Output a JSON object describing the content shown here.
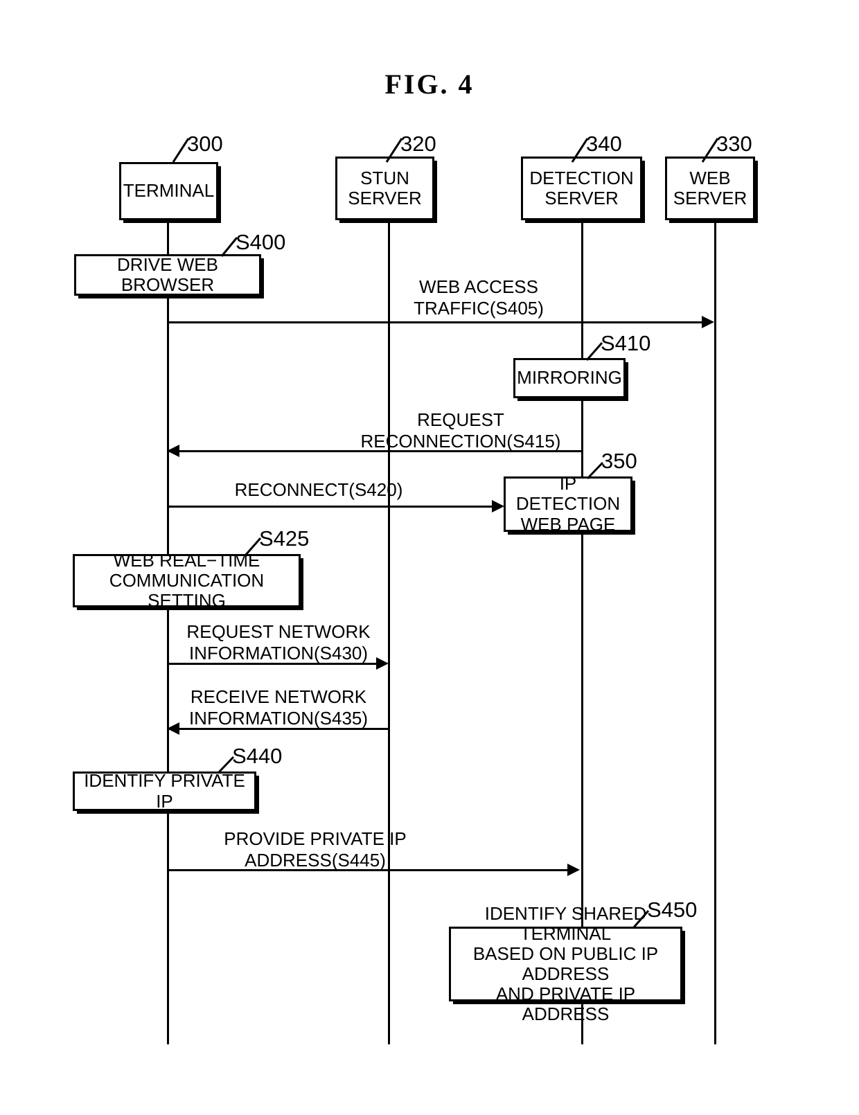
{
  "figure": {
    "title": "FIG.  4",
    "type": "sequence-diagram"
  },
  "actors": [
    {
      "id": "terminal",
      "label": "TERMINAL",
      "ref": "300"
    },
    {
      "id": "stun",
      "label": "STUN\nSERVER",
      "ref": "320"
    },
    {
      "id": "detection",
      "label": "DETECTION\nSERVER",
      "ref": "340"
    },
    {
      "id": "web",
      "label": "WEB\nSERVER",
      "ref": "330"
    }
  ],
  "steps": [
    {
      "id": "s400",
      "ref": "S400",
      "label": "DRIVE WEB BROWSER",
      "on": "terminal"
    },
    {
      "id": "s410",
      "ref": "S410",
      "label": "MIRRORING",
      "on": "detection"
    },
    {
      "id": "s350",
      "ref": "350",
      "label": "IP DETECTION\nWEB PAGE",
      "on": "detection"
    },
    {
      "id": "s425",
      "ref": "S425",
      "label": "WEB REAL−TIME\nCOMMUNICATION SETTING",
      "on": "terminal"
    },
    {
      "id": "s440",
      "ref": "S440",
      "label": "IDENTIFY PRIVATE IP",
      "on": "terminal"
    },
    {
      "id": "s450",
      "ref": "S450",
      "label": "IDENTIFY SHARED TERMINAL\nBASED ON PUBLIC IP ADDRESS\nAND PRIVATE IP ADDRESS",
      "on": "detection"
    }
  ],
  "messages": [
    {
      "id": "s405",
      "label": "WEB ACCESS\nTRAFFIC(S405)",
      "from": "terminal",
      "to": "web",
      "direction": "right"
    },
    {
      "id": "s415",
      "label": "REQUEST\nRECONNECTION(S415)",
      "from": "detection",
      "to": "terminal",
      "direction": "left"
    },
    {
      "id": "s420",
      "label": "RECONNECT(S420)",
      "from": "terminal",
      "to": "detection",
      "direction": "right"
    },
    {
      "id": "s430",
      "label": "REQUEST NETWORK\nINFORMATION(S430)",
      "from": "terminal",
      "to": "stun",
      "direction": "right"
    },
    {
      "id": "s435",
      "label": "RECEIVE NETWORK\nINFORMATION(S435)",
      "from": "stun",
      "to": "terminal",
      "direction": "left"
    },
    {
      "id": "s445",
      "label": "PROVIDE PRIVATE IP\nADDRESS(S445)",
      "from": "terminal",
      "to": "detection",
      "direction": "right"
    }
  ],
  "colors": {
    "ink": "#000000",
    "paper": "#ffffff"
  }
}
